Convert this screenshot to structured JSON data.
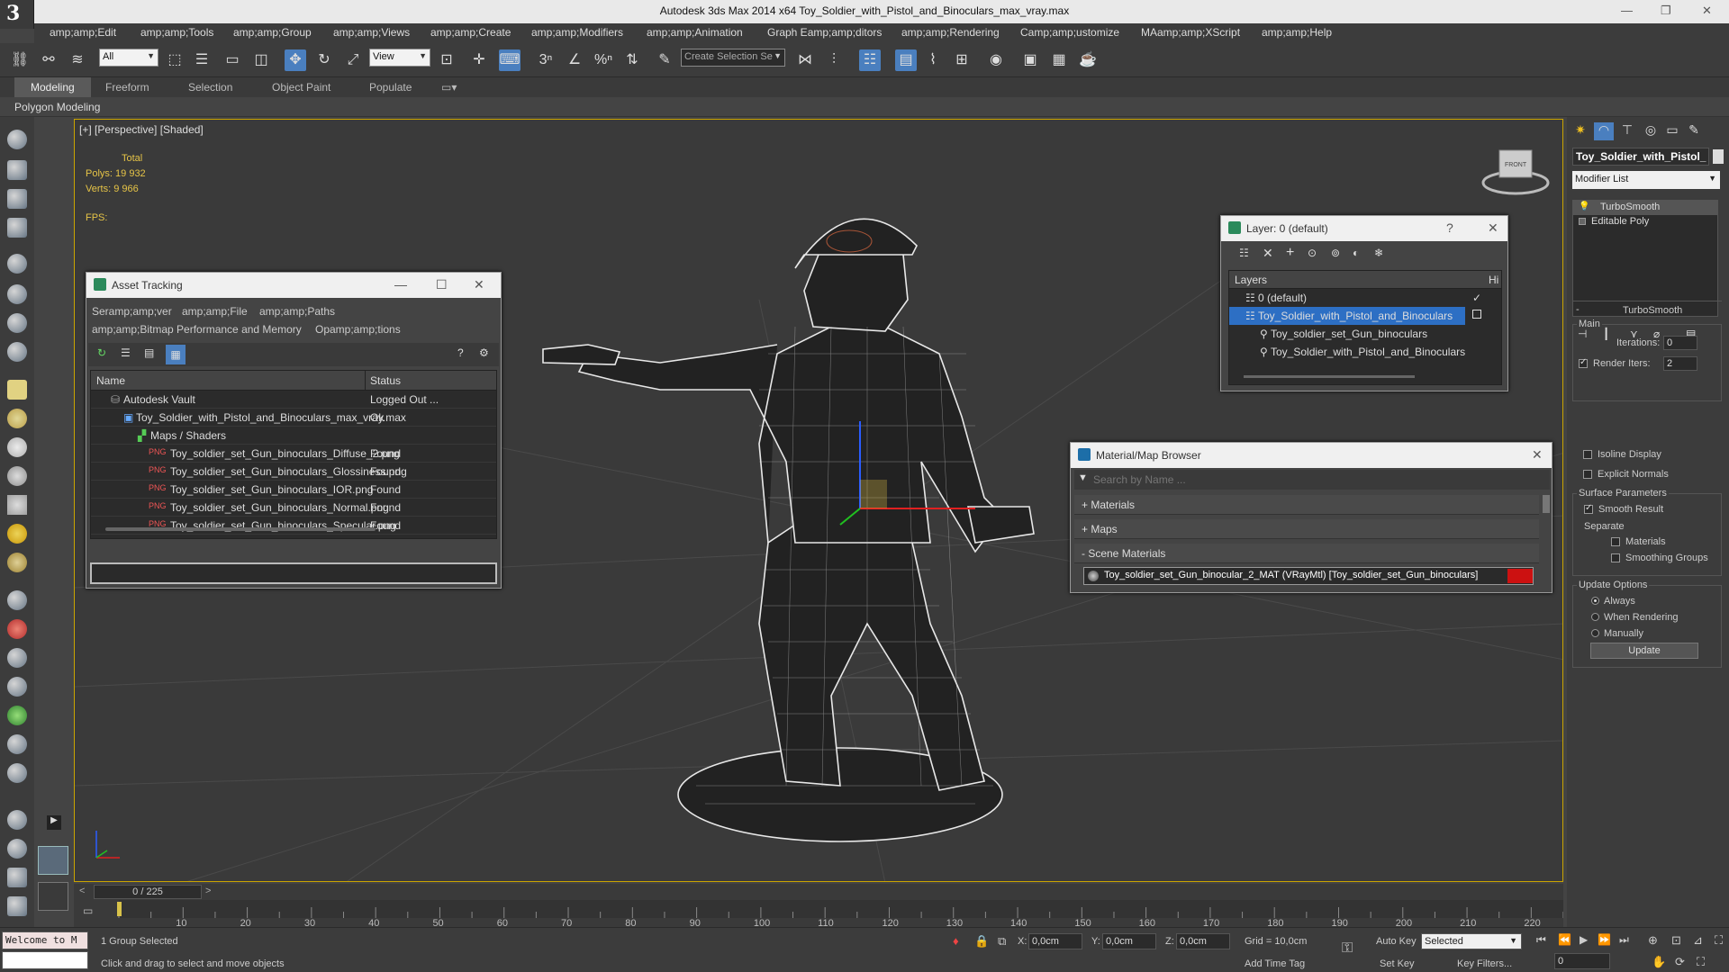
{
  "titlebar": {
    "title": "Autodesk 3ds Max  2014 x64     Toy_Soldier_with_Pistol_and_Binoculars_max_vray.max"
  },
  "menu": [
    "amp;amp;Edit",
    "amp;amp;Tools",
    "amp;amp;Group",
    "amp;amp;Views",
    "amp;amp;Create",
    "amp;amp;Modifiers",
    "amp;amp;Animation",
    "Graph Eamp;amp;ditors",
    "amp;amp;Rendering",
    "Camp;amp;ustomize",
    "MAamp;amp;XScript",
    "amp;amp;Help"
  ],
  "toolbar": {
    "filter_value": "All",
    "refcoord_value": "View",
    "selection_set_placeholder": "Create Selection Se"
  },
  "ribbon": {
    "tabs": [
      "Modeling",
      "Freeform",
      "Selection",
      "Object Paint",
      "Populate"
    ],
    "sub_label": "Polygon Modeling"
  },
  "viewport": {
    "label": "[+] [Perspective] [Shaded]",
    "stats": {
      "total_label": "Total",
      "polys_label": "Polys:",
      "polys_value": "19 932",
      "verts_label": "Verts:",
      "verts_value": "9 966",
      "fps_label": "FPS:"
    }
  },
  "asset_tracking": {
    "title": "Asset Tracking",
    "menu_row1": [
      "Seramp;amp;ver",
      "amp;amp;File",
      "amp;amp;Paths"
    ],
    "menu_row2": [
      "amp;amp;Bitmap Performance and Memory",
      "Opamp;amp;tions"
    ],
    "col_name": "Name",
    "col_status": "Status",
    "rows": [
      {
        "name": "Autodesk Vault",
        "status": "Logged Out ..."
      },
      {
        "name": "Toy_Soldier_with_Pistol_and_Binoculars_max_vray.max",
        "status": "Ok"
      },
      {
        "name": "Maps / Shaders",
        "status": ""
      },
      {
        "name": "Toy_soldier_set_Gun_binoculars_Diffuse_2.png",
        "status": "Found"
      },
      {
        "name": "Toy_soldier_set_Gun_binoculars_Glossiness.png",
        "status": "Found"
      },
      {
        "name": "Toy_soldier_set_Gun_binoculars_IOR.png",
        "status": "Found"
      },
      {
        "name": "Toy_soldier_set_Gun_binoculars_Normal.png",
        "status": "Found"
      },
      {
        "name": "Toy_soldier_set_Gun_binoculars_Specular.png",
        "status": "Found"
      }
    ]
  },
  "layer_manager": {
    "title": "Layer: 0 (default)",
    "help": "?",
    "col_layers": "Layers",
    "col_hide": "Hi",
    "rows": [
      "0 (default)",
      "Toy_Soldier_with_Pistol_and_Binoculars",
      "Toy_soldier_set_Gun_binoculars",
      "Toy_Soldier_with_Pistol_and_Binoculars"
    ]
  },
  "material_browser": {
    "title": "Material/Map Browser",
    "search_placeholder": "Search by Name ...",
    "sections": [
      "+ Materials",
      "+ Maps",
      "- Scene Materials"
    ],
    "material": "Toy_soldier_set_Gun_binocular_2_MAT (VRayMtl) [Toy_soldier_set_Gun_binoculars]",
    "material_color": "#cc1111"
  },
  "command_panel": {
    "object_name": "Toy_Soldier_with_Pistol_",
    "modifier_list": "Modifier List",
    "stack": [
      "TurboSmooth",
      "Editable Poly"
    ],
    "rollout_title": "TurboSmooth",
    "main_label": "Main",
    "iterations_label": "Iterations:",
    "iterations_value": "0",
    "render_iters_label": "Render Iters:",
    "render_iters_value": "2",
    "isoline": "Isoline Display",
    "explicit": "Explicit Normals",
    "surface_params": "Surface Parameters",
    "smooth_result": "Smooth Result",
    "separate": "Separate",
    "materials": "Materials",
    "smoothing_groups": "Smoothing Groups",
    "update_options": "Update Options",
    "always": "Always",
    "when_rendering": "When Rendering",
    "manually": "Manually",
    "update_btn": "Update"
  },
  "timeline": {
    "frame_label": "0 / 225",
    "ticks": [
      "10",
      "20",
      "30",
      "40",
      "50",
      "60",
      "70",
      "80",
      "90",
      "100",
      "110",
      "120",
      "130",
      "140",
      "150",
      "160",
      "170",
      "180",
      "190",
      "200",
      "210",
      "220"
    ]
  },
  "status": {
    "welcome": "Welcome to M",
    "selected": "1 Group Selected",
    "prompt": "Click and drag to select and move objects",
    "x_label": "X:",
    "x_value": "0,0cm",
    "y_label": "Y:",
    "y_value": "0,0cm",
    "z_label": "Z:",
    "z_value": "0,0cm",
    "grid": "Grid = 10,0cm",
    "auto_key": "Auto Key",
    "selected_dd": "Selected",
    "set_key": "Set Key",
    "key_filters": "Key Filters...",
    "add_time_tag": "Add Time Tag",
    "frame_value": "0"
  }
}
